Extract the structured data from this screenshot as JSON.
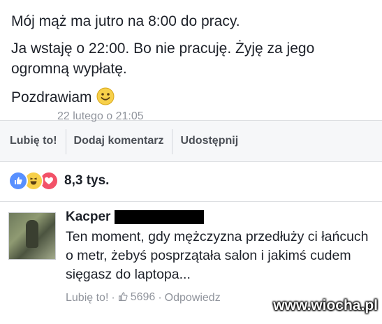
{
  "post": {
    "line1": "Mój mąż ma jutro na 8:00 do pracy.",
    "line2": "Ja wstaję o 22:00. Bo nie pracuję. Żyję za jego ogromną wypłatę.",
    "line3": "Pozdrawiam",
    "emoji": "smiley-emoji"
  },
  "actions": {
    "like": "Lubię to!",
    "comment": "Dodaj komentarz",
    "share": "Udostępnij"
  },
  "reactions": {
    "icons": [
      "like-icon",
      "haha-icon",
      "love-icon"
    ],
    "count": "8,3 tys."
  },
  "comment": {
    "author": "Kacper",
    "text": "Ten moment, gdy mężczyzna przedłuży ci łańcuch o metr, żebyś posprzątała salon i jakimś cudem sięgasz do laptopa...",
    "like_label": "Lubię to!",
    "like_count": "5696",
    "reply_label": "Odpowiedz",
    "time_partial": "22 lutego o 21:05"
  },
  "watermark": "www.wiocha.pl",
  "colors": {
    "like_blue": "#5890ff",
    "haha_yellow": "#f7d04a",
    "love_red": "#f25268",
    "meta_gray": "#90949c",
    "action_bar_bg": "#f6f7f9"
  }
}
